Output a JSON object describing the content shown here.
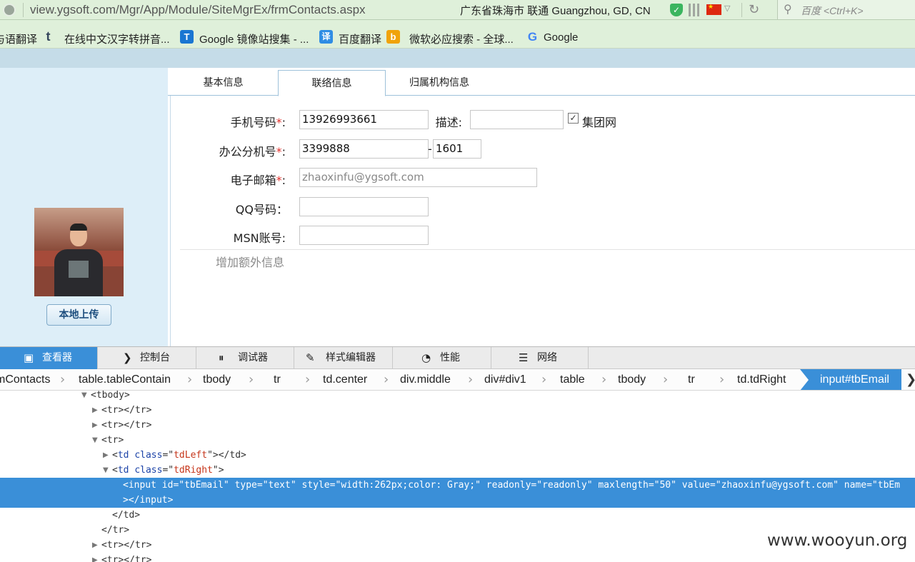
{
  "browser": {
    "url": "view.ygsoft.com/Mgr/App/Module/SiteMgrEx/frmContacts.aspx",
    "location": "广东省珠海市 联通   Guangzhou, GD, CN",
    "search_placeholder": "百度 <Ctrl+K>",
    "icons": [
      "globe-icon",
      "shield-icon",
      "qr-icon",
      "china-flag-icon",
      "reload-icon",
      "search-icon"
    ]
  },
  "bookmarks": [
    {
      "label": "与语翻译",
      "icon": null
    },
    {
      "label": "在线中文汉字转拼音...",
      "icon": "t",
      "icon_color": "#35465c"
    },
    {
      "label": "Google 镜像站搜集 - ...",
      "icon": "T",
      "icon_color": "#1976d2"
    },
    {
      "label": "百度翻译",
      "icon": "译",
      "icon_color": "#2f8de4"
    },
    {
      "label": "微软必应搜索 - 全球...",
      "icon": "b",
      "icon_color": "#f0a30a"
    },
    {
      "label": "Google",
      "icon": "G",
      "icon_color": "#4285f4"
    }
  ],
  "sidebar": {
    "upload_button": "本地上传",
    "photo_alt": "avatar-photo"
  },
  "tabs": [
    {
      "label": "基本信息",
      "active": false
    },
    {
      "label": "联络信息",
      "active": true
    },
    {
      "label": "归属机构信息",
      "active": false
    }
  ],
  "form": {
    "mobile_label": "手机号码",
    "mobile_value": "13926993661",
    "desc_label": "描述:",
    "desc_value": "",
    "group_net_label": "集团网",
    "group_net_checked": true,
    "office_label": "办公分机号",
    "office_value": "3399888",
    "office_ext_sep": "-",
    "office_ext_value": "1601",
    "email_label": "电子邮箱",
    "email_value": "zhaoxinfu@ygsoft.com",
    "qq_label": "QQ号码：",
    "qq_value": "",
    "msn_label": "MSN账号:",
    "msn_value": "",
    "required_mark": "*",
    "extra_info": "增加额外信息"
  },
  "devtools": {
    "tabs": [
      {
        "label": "查看器",
        "icon": "inspector-icon",
        "active": true
      },
      {
        "label": "控制台",
        "icon": "console-icon",
        "active": false
      },
      {
        "label": "调试器",
        "icon": "debugger-icon",
        "active": false
      },
      {
        "label": "样式编辑器",
        "icon": "style-editor-icon",
        "active": false
      },
      {
        "label": "性能",
        "icon": "performance-icon",
        "active": false
      },
      {
        "label": "网络",
        "icon": "network-icon",
        "active": false
      }
    ],
    "breadcrumbs": [
      "mContacts",
      "table.tableContain",
      "tbody",
      "tr",
      "td.center",
      "div.middle",
      "div#div1",
      "table",
      "tbody",
      "tr",
      "td.tdRight"
    ],
    "breadcrumb_active": "input#tbEmail",
    "dom": {
      "tbody_open": "<tbody>",
      "tr_collapsed": "<tr></tr>",
      "tr_open": "<tr>",
      "td_left": {
        "tag": "td",
        "attr": "class",
        "value": "tdLeft",
        "close": "></td>"
      },
      "td_right": {
        "tag": "td",
        "attr": "class",
        "value": "tdRight"
      },
      "input_line": {
        "tag": "input",
        "attrs": [
          {
            "name": "id",
            "value": "tbEmail"
          },
          {
            "name": "type",
            "value": "text"
          },
          {
            "name": "style",
            "value": "width:262px;color: Gray;"
          },
          {
            "name": "readonly",
            "value": "readonly"
          },
          {
            "name": "maxlength",
            "value": "50"
          },
          {
            "name": "value",
            "value": "zhaoxinfu@ygsoft.com"
          },
          {
            "name": "name",
            "value": "tbEm"
          }
        ]
      },
      "input_close": "></input>",
      "td_close": "</td>",
      "tr_close": "</tr>"
    }
  },
  "watermark": "www.wooyun.org",
  "colors": {
    "browser_green": "#dff0da",
    "devtools_accent": "#3a8fd8",
    "required_red": "#e0312c",
    "left_pane": "#ddeef8"
  }
}
